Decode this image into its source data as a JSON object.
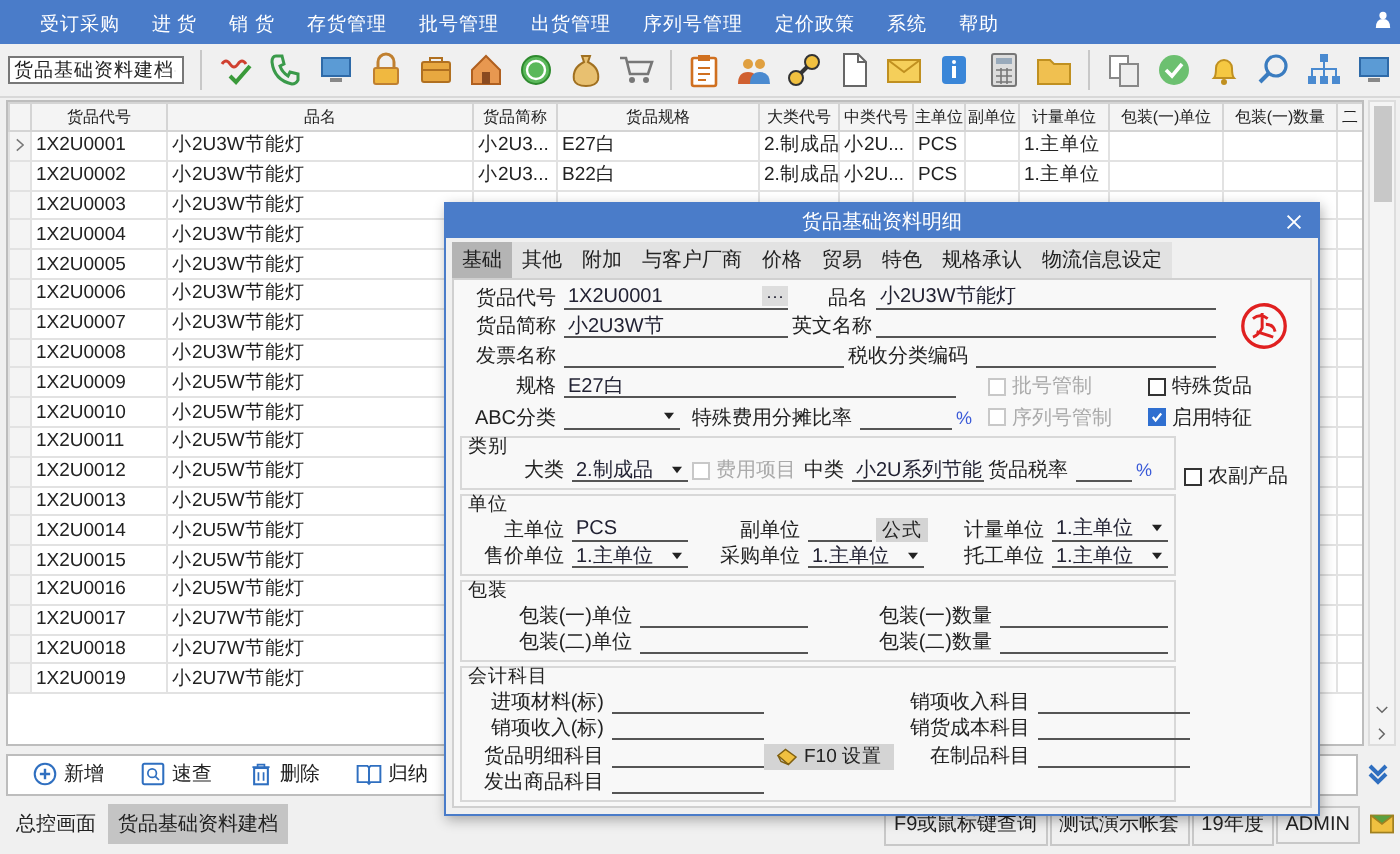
{
  "menu": [
    "受订采购",
    "进 货",
    "销 货",
    "存货管理",
    "批号管理",
    "出货管理",
    "序列号管理",
    "定价政策",
    "系统",
    "帮助"
  ],
  "toolbar": {
    "module_select": "货品基础资料建档"
  },
  "table": {
    "columns": [
      "货品代号",
      "品名",
      "货品简称",
      "货品规格",
      "大类代号",
      "中类代号",
      "主单位",
      "副单位",
      "计量单位",
      "包装(一)单位",
      "包装(一)数量",
      "二"
    ],
    "rows": [
      {
        "selected": true,
        "code": "1X2U0001",
        "name": "小2U3W节能灯",
        "short_name": "小2U3...",
        "spec": "E27白",
        "major_class": "2.制成品",
        "minor_class": "小2U...",
        "main_unit": "PCS",
        "measure_unit": "1.主单位"
      },
      {
        "selected": false,
        "code": "1X2U0002",
        "name": "小2U3W节能灯",
        "short_name": "小2U3...",
        "spec": "B22白",
        "major_class": "2.制成品",
        "minor_class": "小2U...",
        "main_unit": "PCS",
        "measure_unit": "1.主单位"
      },
      {
        "selected": false,
        "code": "1X2U0003",
        "name": "小2U3W节能灯"
      },
      {
        "selected": false,
        "code": "1X2U0004",
        "name": "小2U3W节能灯"
      },
      {
        "selected": false,
        "code": "1X2U0005",
        "name": "小2U3W节能灯"
      },
      {
        "selected": false,
        "code": "1X2U0006",
        "name": "小2U3W节能灯"
      },
      {
        "selected": false,
        "code": "1X2U0007",
        "name": "小2U3W节能灯"
      },
      {
        "selected": false,
        "code": "1X2U0008",
        "name": "小2U3W节能灯"
      },
      {
        "selected": false,
        "code": "1X2U0009",
        "name": "小2U5W节能灯"
      },
      {
        "selected": false,
        "code": "1X2U0010",
        "name": "小2U5W节能灯"
      },
      {
        "selected": false,
        "code": "1X2U0011",
        "name": "小2U5W节能灯"
      },
      {
        "selected": false,
        "code": "1X2U0012",
        "name": "小2U5W节能灯"
      },
      {
        "selected": false,
        "code": "1X2U0013",
        "name": "小2U5W节能灯"
      },
      {
        "selected": false,
        "code": "1X2U0014",
        "name": "小2U5W节能灯"
      },
      {
        "selected": false,
        "code": "1X2U0015",
        "name": "小2U5W节能灯"
      },
      {
        "selected": false,
        "code": "1X2U0016",
        "name": "小2U5W节能灯"
      },
      {
        "selected": false,
        "code": "1X2U0017",
        "name": "小2U7W节能灯"
      },
      {
        "selected": false,
        "code": "1X2U0018",
        "name": "小2U7W节能灯"
      },
      {
        "selected": false,
        "code": "1X2U0019",
        "name": "小2U7W节能灯"
      }
    ]
  },
  "actions": [
    {
      "kind": "add",
      "label": "新增"
    },
    {
      "kind": "search",
      "label": "速查"
    },
    {
      "kind": "delete",
      "label": "删除"
    },
    {
      "kind": "book",
      "label": "归纳"
    }
  ],
  "status_bar": {
    "tabs": [
      {
        "label": "总控画面",
        "selected": false
      },
      {
        "label": "货品基础资料建档",
        "selected": true
      }
    ],
    "fields": [
      "F9或鼠标键查询",
      "测试演示帐套",
      "19年度",
      "ADMIN"
    ]
  },
  "dialog": {
    "title": "货品基础资料明细",
    "tabs": [
      {
        "label": "基础",
        "selected": true
      },
      {
        "label": "其他",
        "selected": false
      },
      {
        "label": "附加",
        "selected": false
      },
      {
        "label": "与客户厂商",
        "selected": false
      },
      {
        "label": "价格",
        "selected": false
      },
      {
        "label": "贸易",
        "selected": false
      },
      {
        "label": "特色",
        "selected": false
      },
      {
        "label": "规格承认",
        "selected": false
      },
      {
        "label": "物流信息设定",
        "selected": false
      }
    ],
    "fields": {
      "item_code": {
        "kind": "lookup",
        "label": "货品代号",
        "value": "1X2U0001",
        "button": "···"
      },
      "item_name": {
        "kind": "text",
        "label": "品名",
        "value": "小2U3W节能灯"
      },
      "short_name": {
        "kind": "text",
        "label": "货品简称",
        "value": "小2U3W节"
      },
      "english_name": {
        "kind": "text",
        "label": "英文名称"
      },
      "invoice_name": {
        "kind": "text",
        "label": "发票名称"
      },
      "tax_code": {
        "kind": "text",
        "label": "税收分类编码"
      },
      "spec": {
        "kind": "text",
        "label": "规格",
        "value": "E27白"
      },
      "abc_class": {
        "kind": "select",
        "label": "ABC分类"
      },
      "expense_ratio": {
        "kind": "text",
        "label": "特殊费用分摊比率",
        "unit": "%"
      }
    },
    "checks": [
      {
        "label": "批号管制",
        "checked": false,
        "disabled": true
      },
      {
        "label": "特殊货品",
        "checked": false,
        "disabled": false
      },
      {
        "label": "序列号管制",
        "checked": false,
        "disabled": true
      },
      {
        "label": "启用特征",
        "checked": true,
        "disabled": false
      }
    ],
    "category": {
      "title": "类别",
      "major": {
        "kind": "select",
        "label": "大类",
        "value": "2.制成品"
      },
      "expense_item": {
        "label": "费用项目",
        "checked": false,
        "disabled": true
      },
      "minor": {
        "kind": "text",
        "label": "中类",
        "value": "小2U系列节能"
      },
      "tax_rate": {
        "kind": "text",
        "label": "货品税率",
        "unit": "%"
      }
    },
    "farm_product": {
      "label": "农副产品",
      "checked": false,
      "disabled": false
    },
    "units": {
      "title": "单位",
      "main": {
        "kind": "text",
        "label": "主单位",
        "value": "PCS"
      },
      "sub": {
        "kind": "text",
        "label": "副单位"
      },
      "formula_button": "公式",
      "measure": {
        "kind": "select",
        "label": "计量单位",
        "value": "1.主单位"
      },
      "sale": {
        "kind": "select",
        "label": "售价单位",
        "value": "1.主单位"
      },
      "purchase": {
        "kind": "select",
        "label": "采购单位",
        "value": "1.主单位"
      },
      "outsource": {
        "kind": "select",
        "label": "托工单位",
        "value": "1.主单位"
      }
    },
    "packing": {
      "title": "包装",
      "fields": [
        {
          "kind": "text",
          "label": "包装(一)单位"
        },
        {
          "kind": "text",
          "label": "包装(一)数量"
        },
        {
          "kind": "text",
          "label": "包装(二)单位"
        },
        {
          "kind": "text",
          "label": "包装(二)数量"
        }
      ]
    },
    "accounts": {
      "title": "会计科目",
      "left": [
        {
          "kind": "text",
          "label": "进项材料(标)"
        },
        {
          "kind": "text",
          "label": "销项收入(标)"
        },
        {
          "kind": "text",
          "label": "货品明细科目"
        },
        {
          "kind": "text",
          "label": "发出商品科目"
        }
      ],
      "button": "F10 设置",
      "right": [
        {
          "kind": "text",
          "label": "销项收入科目"
        },
        {
          "kind": "text",
          "label": "销货成本科目"
        },
        {
          "kind": "text",
          "label": "在制品科目"
        }
      ]
    }
  }
}
